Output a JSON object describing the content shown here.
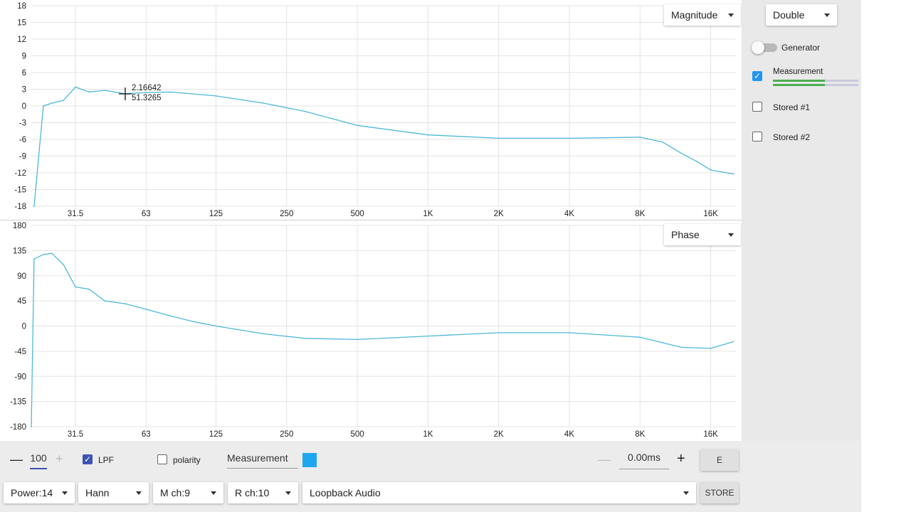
{
  "magnitude_chart": {
    "dropdown_label": "Magnitude",
    "y_ticks": [
      "18",
      "15",
      "12",
      "9",
      "6",
      "3",
      "0",
      "-3",
      "-6",
      "-9",
      "-12",
      "-15",
      "-18"
    ],
    "x_ticks": [
      "31.5",
      "63",
      "125",
      "250",
      "500",
      "1K",
      "2K",
      "4K",
      "8K",
      "16K"
    ],
    "cursor_readout_line1": "2.16642",
    "cursor_readout_line2": "51.3265",
    "line_color": "#4db8d9"
  },
  "phase_chart": {
    "dropdown_label": "Phase",
    "y_ticks": [
      "180",
      "135",
      "90",
      "45",
      "0",
      "-45",
      "-90",
      "-135",
      "-180"
    ],
    "x_ticks": [
      "31.5",
      "63",
      "125",
      "250",
      "500",
      "1K",
      "2K",
      "4K",
      "8K",
      "16K"
    ]
  },
  "chart_data": [
    {
      "type": "line",
      "xscale": "log",
      "x": [
        21,
        23,
        25,
        28,
        31.5,
        36,
        42,
        51.3,
        63,
        80,
        125,
        200,
        300,
        500,
        1000,
        2000,
        4000,
        8000,
        10000,
        12000,
        14000,
        16000,
        20000
      ],
      "y": [
        -18,
        0,
        0.5,
        1,
        3.4,
        2.5,
        2.8,
        2.2,
        2.4,
        2.5,
        1.8,
        0.5,
        -1,
        -3.5,
        -5.2,
        -5.8,
        -5.8,
        -5.6,
        -6.5,
        -8.5,
        -10,
        -11.5,
        -12.2
      ],
      "ylim": [
        -18,
        18
      ]
    },
    {
      "type": "line",
      "xscale": "log",
      "x": [
        20,
        21,
        23,
        25,
        28,
        31.5,
        36,
        42,
        51.3,
        63,
        80,
        100,
        125,
        200,
        300,
        500,
        1000,
        2000,
        4000,
        8000,
        12000,
        16000,
        20000
      ],
      "y": [
        -180,
        120,
        128,
        130,
        110,
        70,
        66,
        45,
        40,
        30,
        18,
        8,
        0,
        -14,
        -22,
        -24,
        -18,
        -12,
        -12,
        -20,
        -38,
        -40,
        -28
      ],
      "ylim": [
        -180,
        180
      ]
    }
  ],
  "right_panel": {
    "mode_dropdown": "Double",
    "generator_label": "Generator",
    "measurement_label": "Measurement",
    "stored1_label": "Stored #1",
    "stored2_label": "Stored #2"
  },
  "controls": {
    "minus_symbol": "—",
    "plus_symbol": "+",
    "smoothing_value": "100",
    "lpf_label": "LPF",
    "polarity_label": "polarity",
    "measurement_field": "Measurement",
    "swatch_color": "#1ea7ef",
    "delay_value": "0.00ms",
    "e_button": "E",
    "power_dropdown": "Power:14",
    "window_dropdown": "Hann",
    "m_channel_dropdown": "M ch:9",
    "r_channel_dropdown": "R ch:10",
    "device_dropdown": "Loopback Audio",
    "store_button": "STORE"
  }
}
